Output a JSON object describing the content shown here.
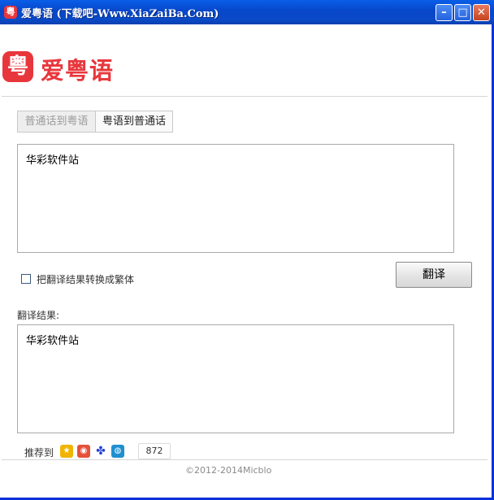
{
  "window": {
    "title": "爱粤语 (下载吧-Www.XiaZaiBa.Com)",
    "icon": "app-icon",
    "minimize_glyph": "–",
    "maximize_glyph": "□",
    "close_glyph": "✕"
  },
  "logo": {
    "glyph": "粤",
    "text": "爱粤语",
    "brand_color": "#e8373c"
  },
  "tabs": [
    {
      "label": "普通话到粤语",
      "active": false
    },
    {
      "label": "粤语到普通话",
      "active": true
    }
  ],
  "input": {
    "value": "华彩软件站"
  },
  "options": {
    "traditional_label": "把翻译结果转换成繁体",
    "traditional_checked": false
  },
  "actions": {
    "translate_label": "翻译"
  },
  "result": {
    "label": "翻译结果:",
    "value": "华彩软件站"
  },
  "share": {
    "label": "推荐到",
    "icons": [
      "qzone-icon",
      "weibo-icon",
      "baidu-icon",
      "tencent-weibo-icon"
    ],
    "count": "872"
  },
  "footer": {
    "copyright": "©2012-2014Micblo"
  }
}
